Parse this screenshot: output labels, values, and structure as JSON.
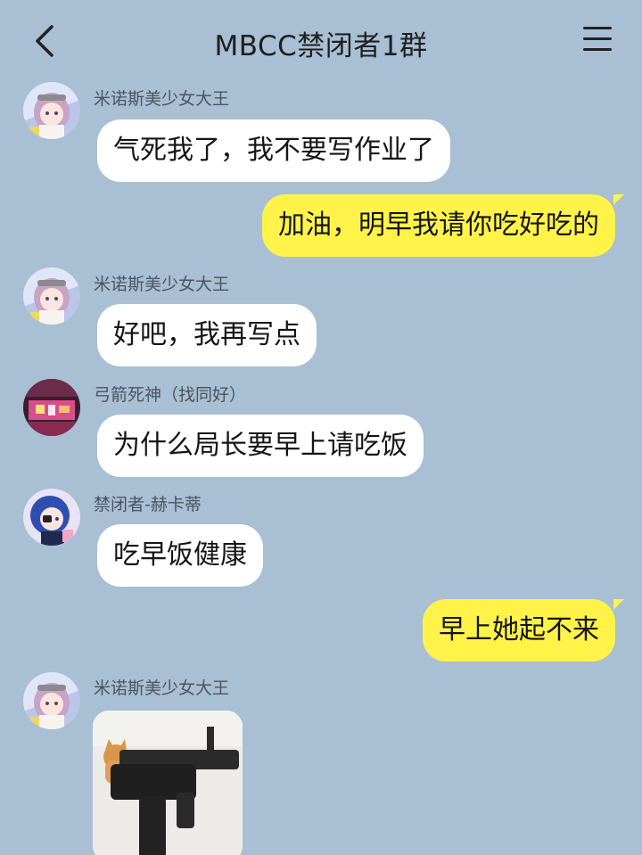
{
  "header": {
    "title": "MBCC禁闭者1群"
  },
  "messages": [
    {
      "sender": "米诺斯美少女大王",
      "text": "气死我了，我不要写作业了"
    },
    {
      "text": "加油，明早我请你吃好吃的"
    },
    {
      "sender": "米诺斯美少女大王",
      "text": "好吧，我再写点"
    },
    {
      "sender": "弓箭死神（找同好）",
      "text": "为什么局长要早上请吃饭"
    },
    {
      "sender": "禁闭者-赫卡蒂",
      "text": "吃早饭健康"
    },
    {
      "text": "早上她起不来"
    },
    {
      "sender": "米诺斯美少女大王"
    }
  ],
  "colors": {
    "background": "#a8bfd4",
    "bubble_left": "#ffffff",
    "bubble_right": "#fff34a"
  },
  "icons": {
    "back": "chevron-left-icon",
    "menu": "hamburger-menu-icon"
  }
}
